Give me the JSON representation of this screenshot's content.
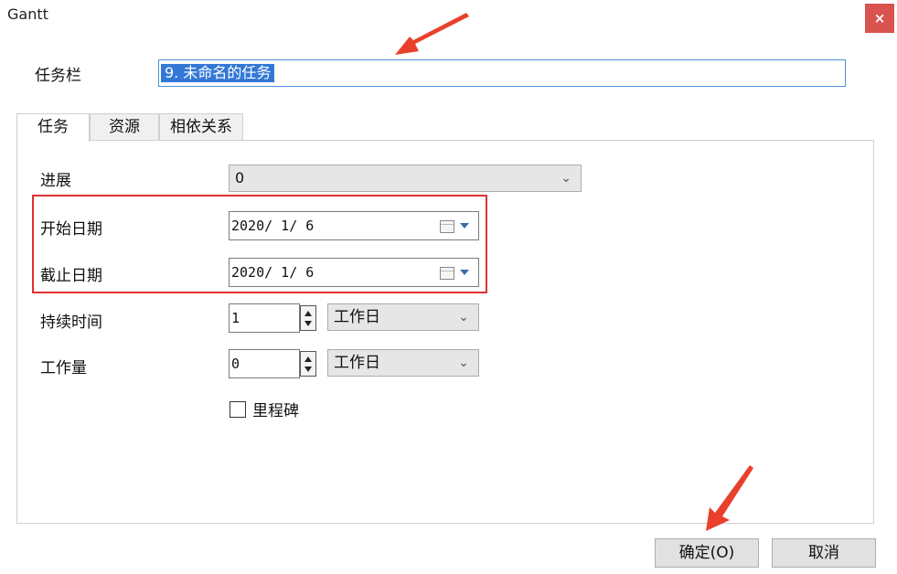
{
  "window": {
    "title": "Gantt",
    "close_glyph": "×"
  },
  "taskbar": {
    "label": "任务栏",
    "value": "9. 未命名的任务"
  },
  "tabs": [
    {
      "label": "任务",
      "active": true
    },
    {
      "label": "资源",
      "active": false
    },
    {
      "label": "相依关系",
      "active": false
    }
  ],
  "form": {
    "progress": {
      "label": "进展",
      "value": "0"
    },
    "start_date": {
      "label": "开始日期",
      "value": "2020/ 1/ 6"
    },
    "end_date": {
      "label": "截止日期",
      "value": "2020/ 1/ 6"
    },
    "duration": {
      "label": "持续时间",
      "value": "1",
      "unit": "工作日"
    },
    "work": {
      "label": "工作量",
      "value": "0",
      "unit": "工作日"
    },
    "milestone": {
      "label": "里程碑",
      "checked": false
    }
  },
  "buttons": {
    "ok": "确定(O)",
    "cancel": "取消"
  },
  "icons": {
    "close": "close-icon",
    "calendar": "calendar-icon",
    "dropdown": "chevron-down-icon",
    "spin": "spinner-arrows-icon"
  },
  "colors": {
    "selection": "#3378d6",
    "highlight_box": "#e03030",
    "annotation_arrow": "#e8402c",
    "close_button": "#d9534f"
  }
}
